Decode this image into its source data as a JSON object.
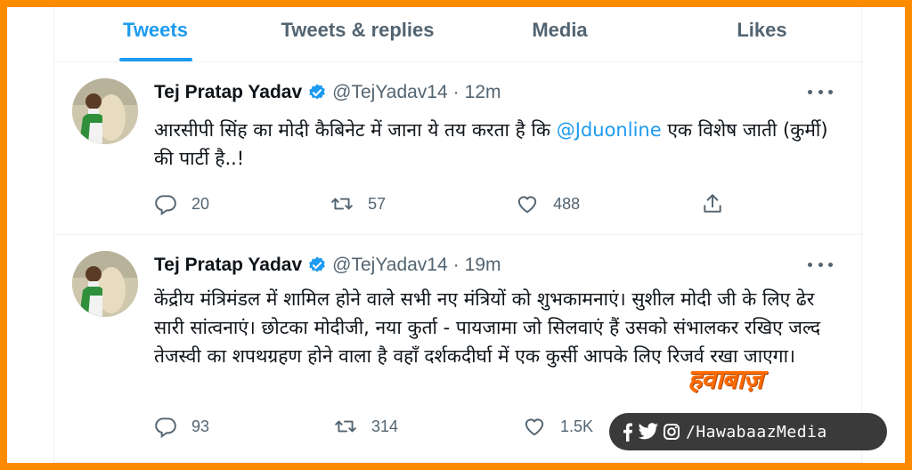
{
  "tabs": [
    {
      "label": "Tweets",
      "active": true
    },
    {
      "label": "Tweets & replies",
      "active": false
    },
    {
      "label": "Media",
      "active": false
    },
    {
      "label": "Likes",
      "active": false
    }
  ],
  "tweets": [
    {
      "author": "Tej Pratap Yadav",
      "handle": "@TejYadav14",
      "time": "12m",
      "text_before": "आरसीपी सिंह का मोदी कैबिनेट में जाना ये तय करता है कि ",
      "mention": "@Jduonline",
      "text_after": " एक विशेष जाती (कुर्मी) की पार्टी है..!",
      "replies": "20",
      "retweets": "57",
      "likes": "488"
    },
    {
      "author": "Tej Pratap Yadav",
      "handle": "@TejYadav14",
      "time": "19m",
      "text": "केंद्रीय मंत्रिमंडल में शामिल होने वाले सभी नए मंत्रियों को शुभकामनाएं। सुशील मोदी जी के लिए ढेर सारी सांत्वनाएं। छोटका मोदीजी, नया कुर्ता - पायजामा जो सिलवाएं हैं उसको संभालकर रखिए जल्द तेजस्वी का शपथग्रहण होने वाला है वहाँ दर्शकदीर्घा में एक कुर्सी आपके लिए रिजर्व रखा जाएगा।",
      "replies": "93",
      "retweets": "314",
      "likes": "1.5K"
    }
  ],
  "watermark": {
    "logo_text": "हवाबाज़",
    "social_handle": "/HawabaazMedia"
  },
  "colors": {
    "accent": "#1d9bf0",
    "frame": "#ff8c00",
    "muted": "#536471"
  },
  "icons": [
    "verified-badge-icon",
    "more-icon",
    "reply-icon",
    "retweet-icon",
    "like-icon",
    "share-icon",
    "facebook-icon",
    "twitter-icon",
    "instagram-icon"
  ]
}
